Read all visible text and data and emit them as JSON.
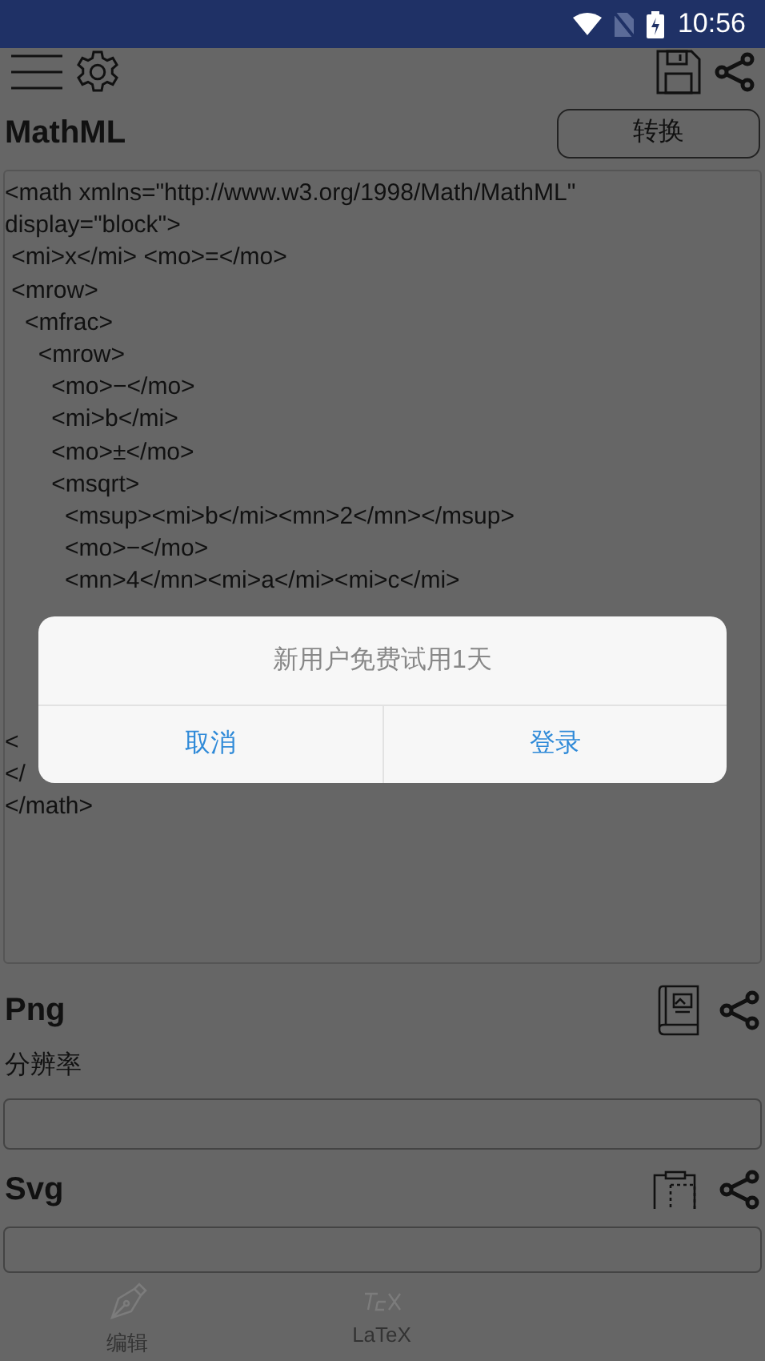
{
  "status_bar": {
    "time": "10:56"
  },
  "mathml": {
    "title": "MathML",
    "convert_button": "转换",
    "code_lines": [
      {
        "text": "<math xmlns=\"http://www.w3.org/1998/Math/MathML\""
      },
      {
        "text": "display=\"block\">"
      },
      {
        "text": " <mi>x</mi> <mo>=</mo>"
      },
      {
        "text": " <mrow>"
      },
      {
        "text": "   <mfrac>"
      },
      {
        "text": "     <mrow>"
      },
      {
        "text": "       <mo>−</mo>"
      },
      {
        "text": "       <mi>b</mi>"
      },
      {
        "text": "       <mo>±</mo>"
      },
      {
        "text": "       <msqrt>"
      },
      {
        "text": "         <msup><mi>b</mi><mn>2</mn></msup>"
      },
      {
        "text": "         <mo>−</mo>"
      },
      {
        "text": "         <mn>4</mn><mi>a</mi><mi>c</mi>"
      }
    ],
    "tail_lines": [
      {
        "text": "<"
      },
      {
        "text": "</"
      },
      {
        "text": "</math>"
      }
    ]
  },
  "png": {
    "title": "Png",
    "resolution_label": "分辨率"
  },
  "svg": {
    "title": "Svg"
  },
  "bottom_nav": [
    {
      "label": "编辑",
      "kind": "pen"
    },
    {
      "label": "LaTeX",
      "kind": "tex"
    }
  ],
  "dialog": {
    "message": "新用户免费试用1天",
    "buttons": [
      "取消",
      "登录"
    ]
  }
}
